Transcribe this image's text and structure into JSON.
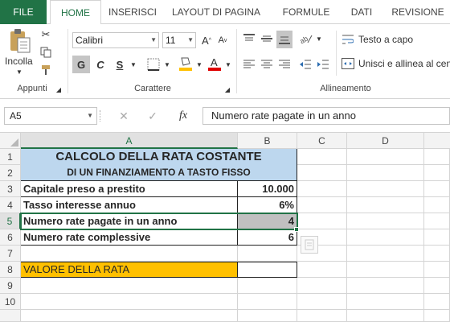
{
  "ribbon": {
    "tabs": [
      "FILE",
      "HOME",
      "INSERISCI",
      "LAYOUT DI PAGINA",
      "FORMULE",
      "DATI",
      "REVISIONE"
    ],
    "clipboard": {
      "paste_label": "Incolla",
      "group_label": "Appunti"
    },
    "font": {
      "font_name": "Calibri",
      "font_size": "11",
      "grow_label": "A",
      "shrink_label": "A",
      "bold_label": "G",
      "italic_label": "C",
      "underline_label": "S",
      "group_label": "Carattere"
    },
    "alignment": {
      "wrap_label": "Testo a capo",
      "merge_label": "Unisci e allinea al cent",
      "group_label": "Allineamento"
    }
  },
  "formula_bar": {
    "name_box": "A5",
    "cancel_icon": "✕",
    "confirm_icon": "✓",
    "fx_label": "fx",
    "content": "Numero rate pagate in un anno"
  },
  "sheet": {
    "columns": [
      "A",
      "B",
      "C",
      "D"
    ],
    "rows": [
      "1",
      "2",
      "3",
      "4",
      "5",
      "6",
      "7",
      "8",
      "9",
      "10"
    ],
    "cells": {
      "a1": "CALCOLO DELLA RATA COSTANTE",
      "a2": "DI UN FINANZIAMENTO A TASTO FISSO",
      "a3": "Capitale preso a prestito",
      "b3": "10.000",
      "a4": "Tasso interesse annuo",
      "b4": "6%",
      "a5": "Numero rate pagate in un anno",
      "b5": "4",
      "a6": "Numero rate complessive",
      "b6": "6",
      "a8": "VALORE DELLA RATA"
    }
  },
  "colors": {
    "accent": "#217346",
    "title_band": "#bdd7ee",
    "result_band": "#ffc000",
    "selected_cell": "#c0c0c0"
  }
}
